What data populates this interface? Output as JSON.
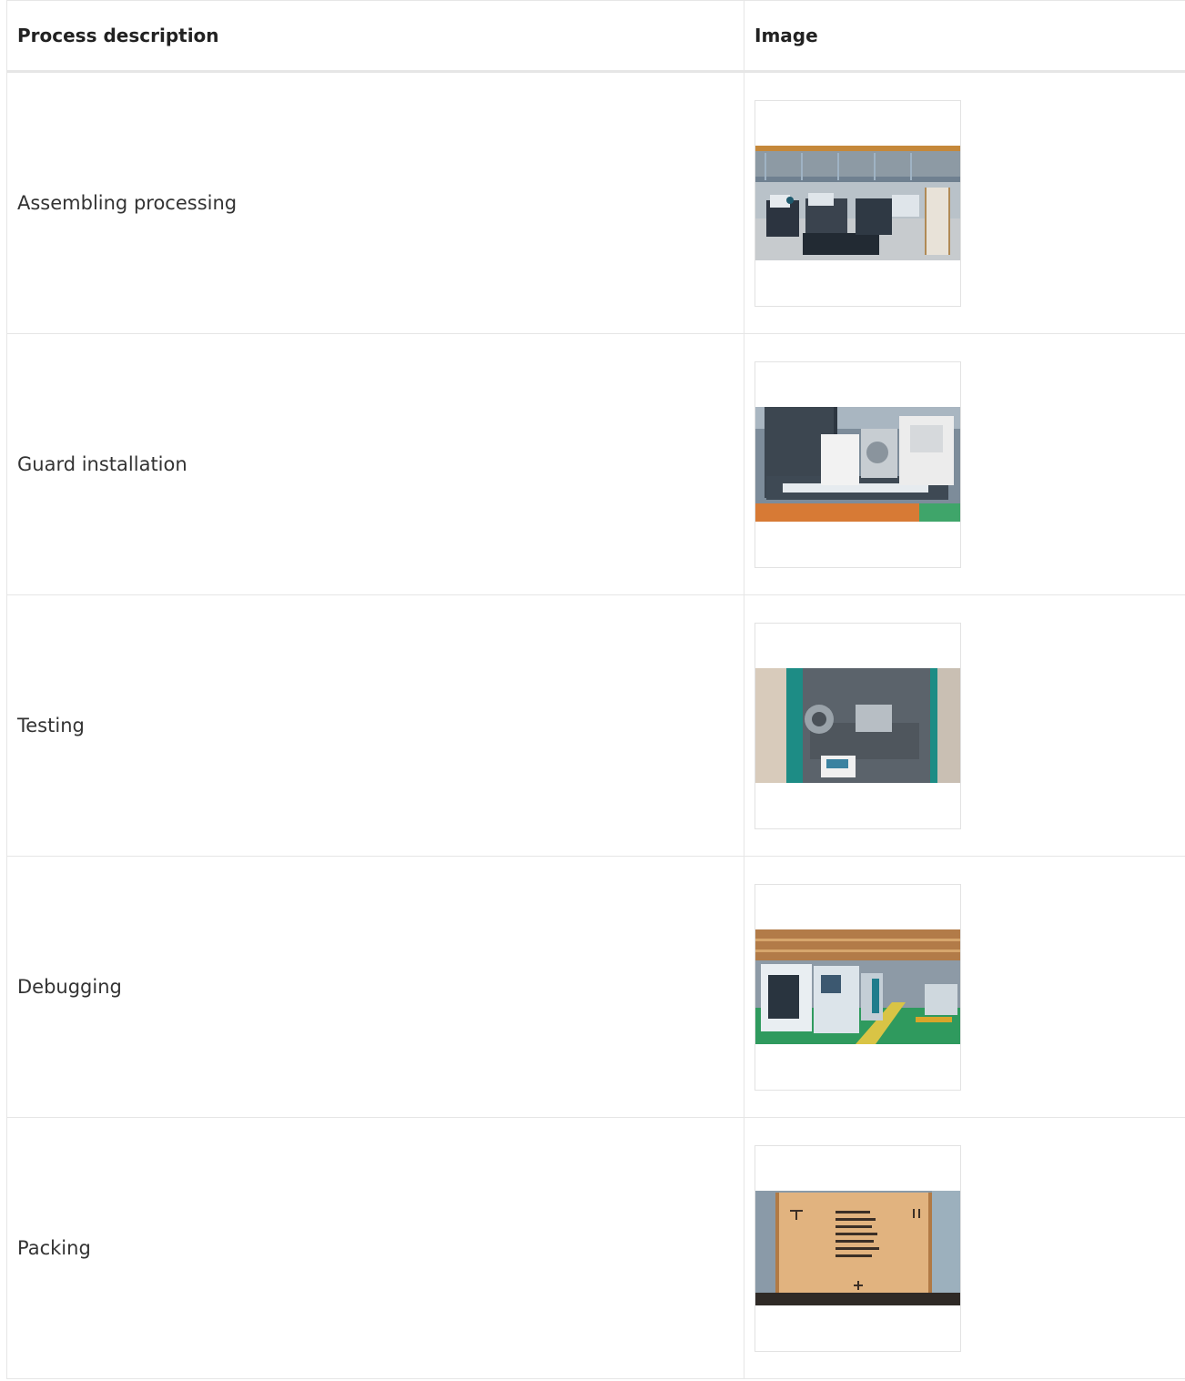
{
  "table": {
    "headers": {
      "process_description": "Process description",
      "image": "Image"
    },
    "rows": [
      {
        "description": "Assembling processing",
        "image_icon": "factory-floor-photo"
      },
      {
        "description": "Guard installation",
        "image_icon": "lathe-machine-photo"
      },
      {
        "description": "Testing",
        "image_icon": "machine-interior-photo"
      },
      {
        "description": "Debugging",
        "image_icon": "production-line-photo"
      },
      {
        "description": "Packing",
        "image_icon": "wooden-crate-photo"
      }
    ]
  }
}
